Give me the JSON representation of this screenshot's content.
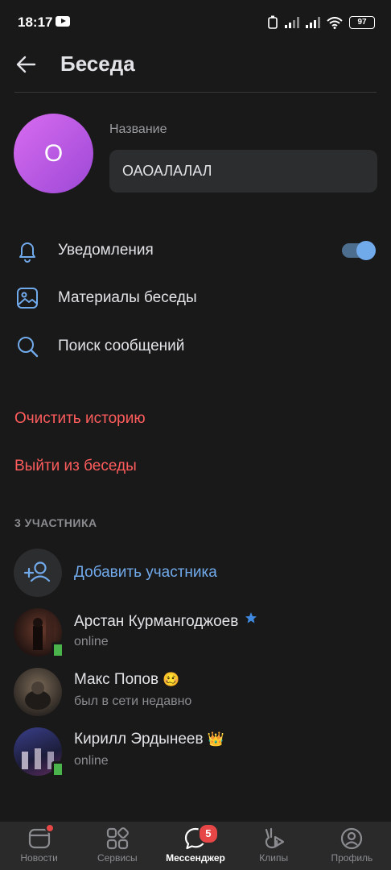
{
  "status_bar": {
    "time": "18:17",
    "battery": "97"
  },
  "header": {
    "title": "Беседа"
  },
  "chat": {
    "avatar_letter": "О",
    "name_label": "Название",
    "name_value": "ОАОАЛАЛАЛ"
  },
  "menu": {
    "notifications": "Уведомления",
    "materials": "Материалы беседы",
    "search": "Поиск сообщений",
    "notifications_enabled": true
  },
  "actions": {
    "clear_history": "Очистить историю",
    "leave_chat": "Выйти из беседы"
  },
  "members": {
    "count_title": "3 УЧАСТНИКА",
    "add_label": "Добавить участника",
    "list": [
      {
        "name": "Арстан Курмангоджоев",
        "status": "online",
        "badge": "star",
        "online": true
      },
      {
        "name": "Макс Попов",
        "status": "был в сети недавно",
        "emoji": "🥴",
        "online": false
      },
      {
        "name": "Кирилл Эрдынеев",
        "status": "online",
        "emoji": "👑",
        "online": true
      }
    ]
  },
  "tabs": [
    {
      "label": "Новости",
      "icon": "news-icon",
      "dot": true
    },
    {
      "label": "Сервисы",
      "icon": "services-icon"
    },
    {
      "label": "Мессенджер",
      "icon": "messenger-icon",
      "active": true,
      "badge": "5"
    },
    {
      "label": "Клипы",
      "icon": "clips-icon"
    },
    {
      "label": "Профиль",
      "icon": "profile-icon"
    }
  ],
  "colors": {
    "accent": "#71aaeb",
    "danger": "#ff5c5c",
    "background": "#19191a",
    "online": "#4bb34b"
  }
}
